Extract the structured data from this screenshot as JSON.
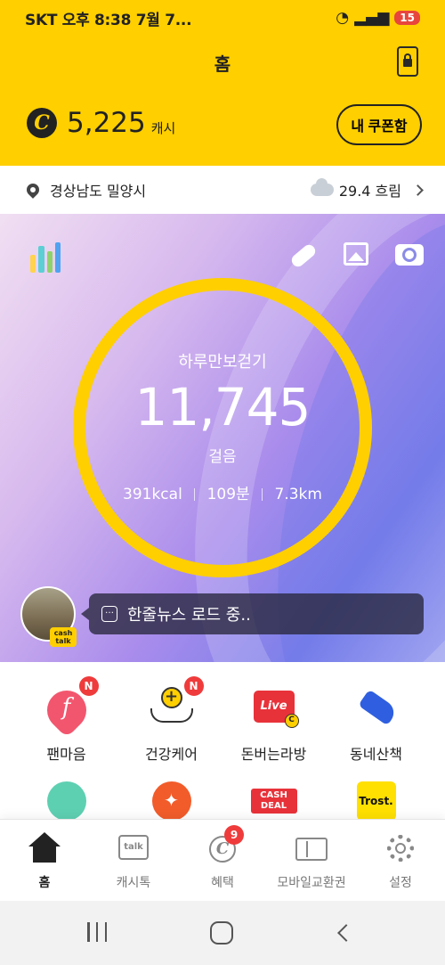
{
  "status_bar": {
    "left": "SKT 오후 8:38  7월 7...",
    "battery": "15"
  },
  "header": {
    "title": "홈",
    "cash_icon": "C",
    "cash_amount": "5,225",
    "cash_unit": "캐시",
    "coupon_label": "내 쿠폰함"
  },
  "location": {
    "place": "경상남도 밀양시",
    "weather": "29.4 흐림"
  },
  "walk": {
    "label": "하루만보걷기",
    "steps": "11,745",
    "unit": "걸음",
    "kcal": "391kcal",
    "minutes": "109분",
    "distance": "7.3km"
  },
  "news": {
    "tag": "cash talk",
    "text": "한줄뉴스 로드 중.."
  },
  "menu": {
    "items": [
      {
        "label": "팬마음",
        "badge": "N",
        "icon_text": "f"
      },
      {
        "label": "건강케어",
        "badge": "N"
      },
      {
        "label": "돈버는라방",
        "icon_text": "Live",
        "coin": "C"
      },
      {
        "label": "동네산책"
      }
    ],
    "row2": [
      {
        "icon": "mascot-icon"
      },
      {
        "icon": "orange-icon"
      },
      {
        "icon_text": "CASH DEAL"
      },
      {
        "icon_text": "Trost."
      }
    ]
  },
  "bottom_nav": [
    {
      "label": "홈",
      "active": true
    },
    {
      "label": "캐시톡",
      "icon_text": "talk"
    },
    {
      "label": "혜택",
      "icon_text": "C",
      "badge": "9"
    },
    {
      "label": "모바일교환권"
    },
    {
      "label": "설정"
    }
  ],
  "colors": {
    "brand_yellow": "#ffcf00",
    "badge_red": "#ef3b3b"
  }
}
